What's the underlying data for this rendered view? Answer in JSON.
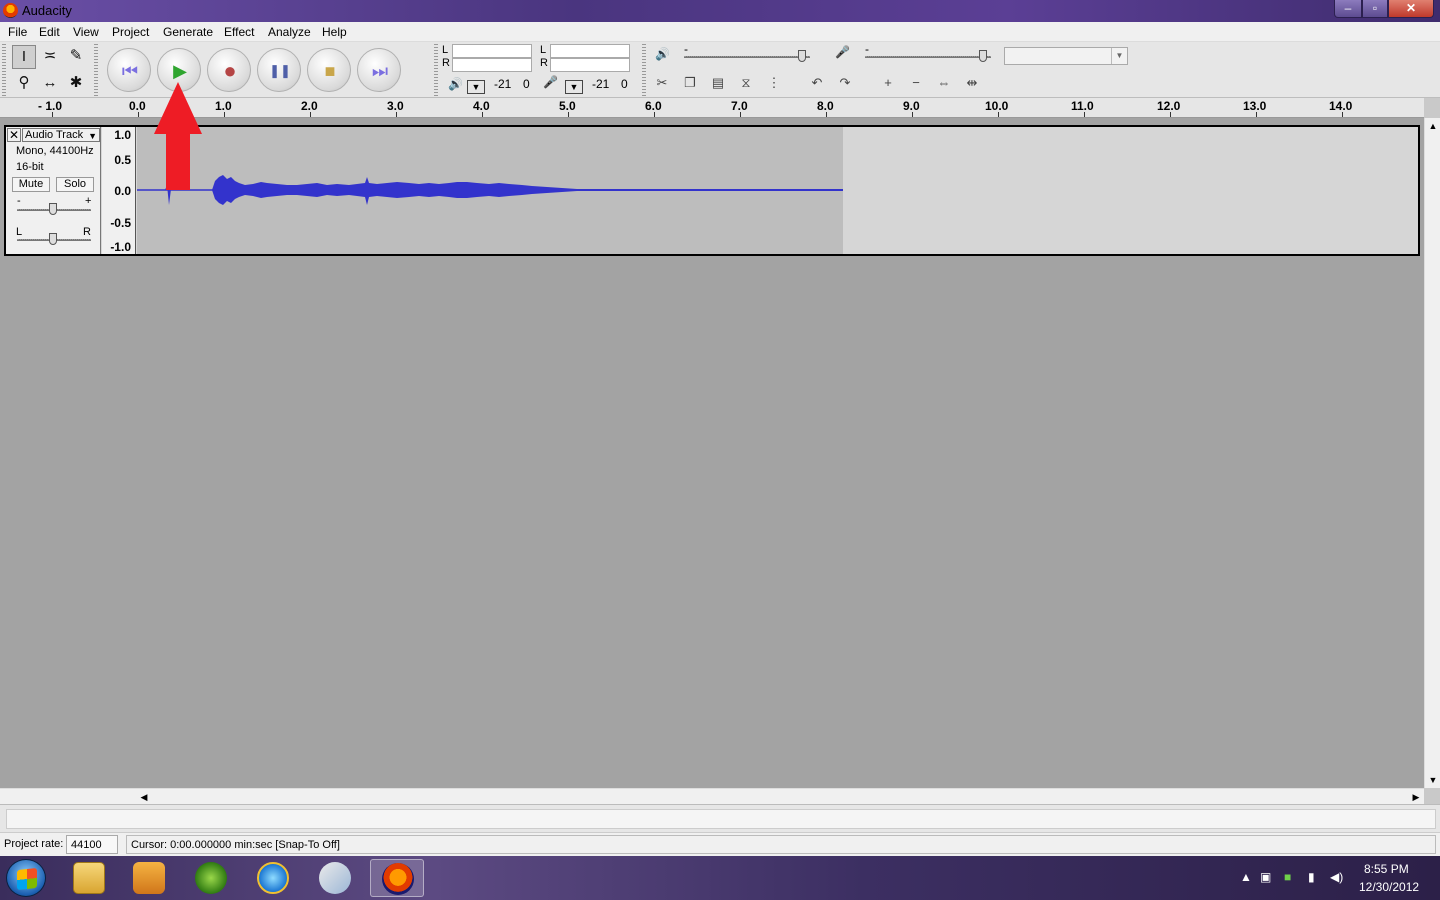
{
  "window": {
    "title": "Audacity",
    "min": "–",
    "max": "▫",
    "close": "✕"
  },
  "menu": [
    "File",
    "Edit",
    "View",
    "Project",
    "Generate",
    "Effect",
    "Analyze",
    "Help"
  ],
  "tools": {
    "selection": "I",
    "envelope": "≍",
    "draw": "✎",
    "zoom": "⚲",
    "timeshift": "↔",
    "multi": "✱"
  },
  "transport": {
    "skip_start": "⏮",
    "play": "▶",
    "record": "●",
    "pause": "❚❚",
    "stop": "■",
    "skip_end": "⏭"
  },
  "meters": {
    "play_L": "L",
    "play_R": "R",
    "rec_L": "L",
    "rec_R": "R",
    "play_db": "-21",
    "play_zero": "0",
    "rec_db": "-21",
    "rec_zero": "0"
  },
  "mixer": {
    "output_icon": "🔊",
    "input_icon": "🎤",
    "output_min": "-",
    "input_min": "-"
  },
  "edit_icons": {
    "trim": "⧖",
    "silence": "⋮",
    "undo": "↶",
    "redo": "↷",
    "zoom_in": "+",
    "zoom_out": "−",
    "fit_selection": "⇔",
    "fit_project": "⇹"
  },
  "ruler": {
    "ticks": [
      "- 1.0",
      "0.0",
      "1.0",
      "2.0",
      "3.0",
      "4.0",
      "5.0",
      "6.0",
      "7.0",
      "8.0",
      "9.0",
      "10.0",
      "11.0",
      "12.0",
      "13.0",
      "14.0"
    ]
  },
  "track": {
    "close": "✕",
    "name": "Audio Track",
    "dropdown": "▼",
    "format": "Mono, 44100Hz",
    "bit_depth": "16-bit",
    "mute": "Mute",
    "solo": "Solo",
    "gain_minus": "-",
    "gain_plus": "+",
    "pan_left": "L",
    "pan_right": "R",
    "vruler": [
      "1.0",
      "0.5",
      "0.0",
      "-0.5",
      "-1.0"
    ]
  },
  "scroll": {
    "up": "▲",
    "down": "▼",
    "left": "◀",
    "right": "▶"
  },
  "status": {
    "rate_label": "Project rate:",
    "rate_value": "44100",
    "cursor_text": "Cursor: 0:00.000000 min:sec  [Snap-To Off]"
  },
  "taskbar": {
    "apps": [
      "explorer-icon",
      "media-player-icon",
      "windows-media-center-icon",
      "internet-explorer-icon",
      "paint-icon",
      "audacity-icon"
    ],
    "tray_arrow": "▲",
    "time": "8:55 PM",
    "date": "12/30/2012"
  },
  "colors": {
    "waveform": "#3333cc",
    "arrow": "#ee1c25",
    "title_bar": "#4a357f"
  }
}
